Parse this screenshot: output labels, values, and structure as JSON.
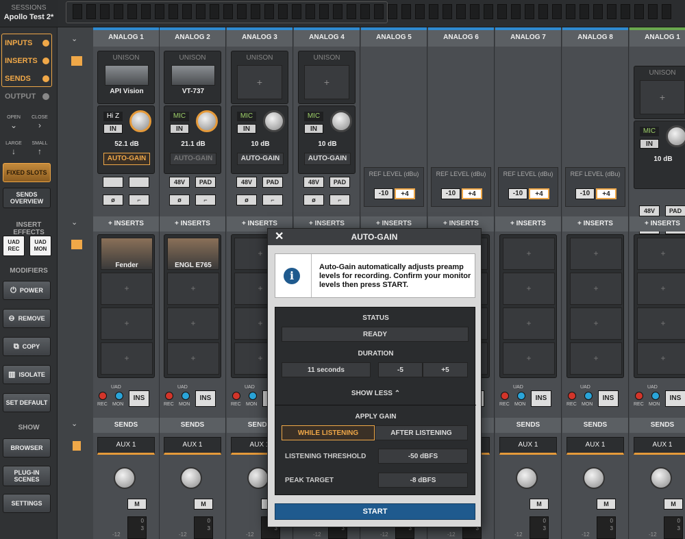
{
  "sidebar": {
    "sessions_label": "SESSIONS",
    "session_name": "Apollo Test 2*",
    "view_toggles": [
      {
        "label": "INPUTS",
        "on": true
      },
      {
        "label": "INSERTS",
        "on": true
      },
      {
        "label": "SENDS",
        "on": true
      },
      {
        "label": "OUTPUT",
        "on": false
      }
    ],
    "open_label": "OPEN",
    "close_label": "CLOSE",
    "large_label": "LARGE",
    "small_label": "SMALL",
    "fixed_slots_label": "FIXED SLOTS",
    "sends_overview_label": "SENDS OVERVIEW",
    "insert_effects_header": "INSERT EFFECTS",
    "uad_rec_label": "UAD REC",
    "uad_mon_label": "UAD MON",
    "modifiers_header": "MODIFIERS",
    "power_label": "POWER",
    "remove_label": "REMOVE",
    "copy_label": "COPY",
    "isolate_label": "ISOLATE",
    "set_default_label": "SET DEFAULT",
    "show_header": "SHOW",
    "browser_label": "BROWSER",
    "plugin_scenes_label": "PLUG-IN SCENES",
    "settings_label": "SETTINGS"
  },
  "channels": [
    {
      "name": "ANALOG 1",
      "unison_label": "UNISON",
      "plugin": "API Vision",
      "input": "Hi Z",
      "in_label": "IN",
      "gain": "52.1 dB",
      "autogain": "AUTO-GAIN",
      "insert": "Fender",
      "send": "AUX 1"
    },
    {
      "name": "ANALOG 2",
      "unison_label": "UNISON",
      "plugin": "VT-737",
      "input": "MIC",
      "in_label": "IN",
      "gain": "21.1 dB",
      "autogain": "AUTO-GAIN",
      "v48": "48V",
      "pad": "PAD",
      "insert": "ENGL E765",
      "send": "AUX 1"
    },
    {
      "name": "ANALOG 3",
      "unison_label": "UNISON",
      "input": "MIC",
      "in_label": "IN",
      "gain": "10 dB",
      "autogain": "AUTO-GAIN",
      "v48": "48V",
      "pad": "PAD",
      "send": "AUX 1"
    },
    {
      "name": "ANALOG 4",
      "unison_label": "UNISON",
      "input": "MIC",
      "in_label": "IN",
      "gain": "10 dB",
      "autogain": "AUTO-GAIN",
      "v48": "48V",
      "pad": "PAD"
    },
    {
      "name": "ANALOG 5",
      "ref_level": "REF LEVEL (dBu)",
      "m10": "-10",
      "p4": "+4"
    },
    {
      "name": "ANALOG 6",
      "ref_level": "REF LEVEL (dBu)",
      "m10": "-10",
      "p4": "+4"
    },
    {
      "name": "ANALOG 7",
      "ref_level": "REF LEVEL (dBu)",
      "m10": "-10",
      "p4": "+4",
      "send": "AUX 1"
    },
    {
      "name": "ANALOG 8",
      "ref_level": "REF LEVEL (dBu)",
      "m10": "-10",
      "p4": "+4",
      "send": "AUX 1"
    },
    {
      "name": "ANALOG 1",
      "unison_label": "UNISON",
      "input": "MIC",
      "in_label": "IN",
      "gain": "10 dB",
      "v48": "48V",
      "pad": "PAD",
      "send": "AUX 1"
    }
  ],
  "section": {
    "inserts_label": "INSERTS",
    "sends_label": "SENDS",
    "uad_label": "UAD",
    "rec_label": "REC",
    "mon_label": "MON",
    "ins_label": "INS",
    "m_label": "M",
    "plus": "+",
    "phase": "ø"
  },
  "modal": {
    "title": "AUTO-GAIN",
    "info_text": "Auto-Gain automatically adjusts preamp levels for recording. Confirm your monitor levels then press START.",
    "status_label": "STATUS",
    "status_value": "READY",
    "duration_label": "DURATION",
    "duration_value": "11 seconds",
    "minus5": "-5",
    "plus5": "+5",
    "show_less": "SHOW LESS",
    "apply_gain_label": "APPLY GAIN",
    "while_listening": "WHILE LISTENING",
    "after_listening": "AFTER LISTENING",
    "threshold_label": "LISTENING THRESHOLD",
    "threshold_value": "-50 dBFS",
    "peak_label": "PEAK TARGET",
    "peak_value": "-8 dBFS",
    "start_label": "START"
  },
  "meter": {
    "m12": "-12",
    "z": "0",
    "t": "3"
  },
  "colors": {
    "accent": "#f0a848",
    "blue": "#1f5a8e",
    "channel_bar": "#2f8ad0"
  }
}
